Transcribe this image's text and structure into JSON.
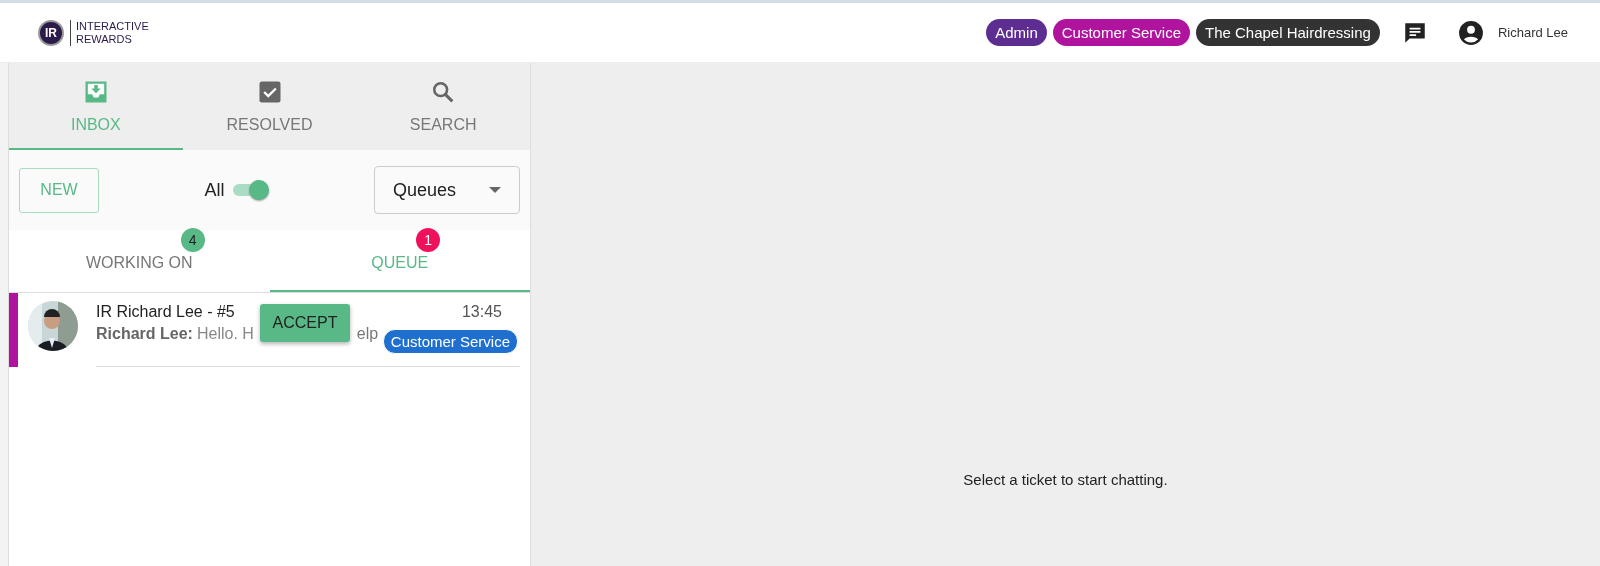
{
  "logo": {
    "mark": "IR",
    "line1": "INTERACTIVE",
    "line2": "REWARDS"
  },
  "header": {
    "roles": [
      {
        "label": "Admin",
        "color": "#5e2d91"
      },
      {
        "label": "Customer Service",
        "color": "#b0139e"
      },
      {
        "label": "The Chapel Hairdressing",
        "color": "#333333"
      }
    ],
    "user": "Richard Lee"
  },
  "tabs": [
    {
      "label": "INBOX",
      "kind": "inbox",
      "selected": true
    },
    {
      "label": "RESOLVED",
      "kind": "check",
      "selected": false
    },
    {
      "label": "SEARCH",
      "kind": "search",
      "selected": false
    }
  ],
  "toolbar": {
    "new_button": "NEW",
    "toggle": {
      "label": "All",
      "on": true
    },
    "queues": {
      "value": "Queues"
    }
  },
  "subtabs": [
    {
      "label": "WORKING ON",
      "count": "4",
      "selected": false,
      "color": "#58b987"
    },
    {
      "label": "QUEUE",
      "count": "1",
      "selected": true,
      "color": "#f0115c"
    }
  ],
  "tickets": [
    {
      "title": "IR Richard Lee - #5",
      "time": "13:45",
      "sender": "Richard Lee:",
      "preview": "Hello. H",
      "preview_tail": "elp",
      "accept": "ACCEPT",
      "tag": "Customer Service",
      "color": "#b0139e"
    }
  ],
  "empty_message": "Select a ticket to start chatting."
}
